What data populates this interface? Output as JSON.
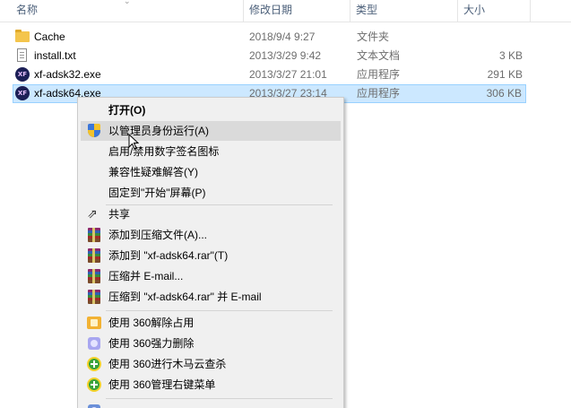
{
  "columns": {
    "name": "名称",
    "date": "修改日期",
    "type": "类型",
    "size": "大小"
  },
  "files": [
    {
      "icon": "folder-icon",
      "name": "Cache",
      "date": "2018/9/4 9:27",
      "type": "文件夹",
      "size": ""
    },
    {
      "icon": "text-file-icon",
      "name": "install.txt",
      "date": "2013/3/29 9:42",
      "type": "文本文档",
      "size": "3 KB"
    },
    {
      "icon": "exe-app-icon",
      "name": "xf-adsk32.exe",
      "date": "2013/3/27 21:01",
      "type": "应用程序",
      "size": "291 KB"
    },
    {
      "icon": "exe-app-icon",
      "name": "xf-adsk64.exe",
      "date": "2013/3/27 23:14",
      "type": "应用程序",
      "size": "306 KB",
      "selected": true
    }
  ],
  "exe_icon_text": "XF",
  "context_menu": {
    "items": [
      {
        "label": "打开(O)",
        "bold": true,
        "icon": ""
      },
      {
        "label": "以管理员身份运行(A)",
        "icon": "uac-shield-icon",
        "hover": true
      },
      {
        "label": "启用/禁用数字签名图标",
        "icon": ""
      },
      {
        "label": "兼容性疑难解答(Y)",
        "icon": ""
      },
      {
        "label": "固定到\"开始\"屏幕(P)",
        "icon": ""
      },
      {
        "label": "共享",
        "icon": "share-icon"
      },
      {
        "label": "添加到压缩文件(A)...",
        "icon": "winrar-icon"
      },
      {
        "label": "添加到 \"xf-adsk64.rar\"(T)",
        "icon": "winrar-icon"
      },
      {
        "label": "压缩并 E-mail...",
        "icon": "winrar-icon"
      },
      {
        "label": "压缩到 \"xf-adsk64.rar\" 并 E-mail",
        "icon": "winrar-icon"
      },
      {
        "label": "使用 360解除占用",
        "icon": "360-unlock-icon"
      },
      {
        "label": "使用 360强力删除",
        "icon": "360-delete-icon"
      },
      {
        "label": "使用 360进行木马云查杀",
        "icon": "360-scan-icon"
      },
      {
        "label": "使用 360管理右键菜单",
        "icon": "360-menu-icon"
      }
    ]
  },
  "colors": {
    "selection_bg": "#cce8ff",
    "selection_border": "#99d1ff",
    "menu_bg": "#f0f0f0",
    "menu_hover": "#dadada",
    "header_text": "#4c607a",
    "secondary_text": "#6d6d6d"
  }
}
